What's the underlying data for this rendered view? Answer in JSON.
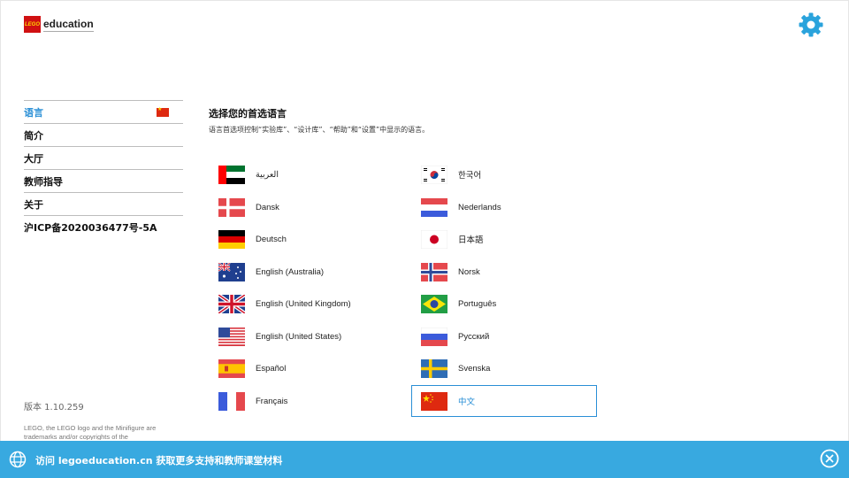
{
  "header": {
    "logo_brick": "LEGO",
    "logo_text": "education"
  },
  "sidebar": {
    "items": [
      {
        "label": "语言",
        "active": true
      },
      {
        "label": "简介"
      },
      {
        "label": "大厅"
      },
      {
        "label": "教师指导"
      },
      {
        "label": "关于"
      },
      {
        "label": "沪ICP备2020036477号-5A"
      }
    ]
  },
  "footer": {
    "version": "版本 1.10.259",
    "legal": "LEGO, the LEGO logo and the Minifigure are trademarks and/or copyrights of the"
  },
  "main": {
    "title": "选择您的首选语言",
    "subtitle": "语言首选项控制“实验库”、“设计库”、“帮助”和“设置”中显示的语言。",
    "languages_left": [
      "العربية",
      "Dansk",
      "Deutsch",
      "English (Australia)",
      "English (United Kingdom)",
      "English (United States)",
      "Español",
      "Français"
    ],
    "languages_right": [
      "한국어",
      "Nederlands",
      "日本語",
      "Norsk",
      "Português",
      "Русский",
      "Svenska",
      "中文"
    ],
    "selected": "中文"
  },
  "banner": {
    "text": "访问 legoeducation.cn 获取更多支持和教师课堂材料"
  },
  "colors": {
    "accent": "#2a8fd6",
    "banner": "#38a9e0",
    "gear": "#2aa3dc",
    "brick": "#d01012"
  },
  "icons": {
    "settings": "gear-icon",
    "banner": "globe-icon",
    "close": "close-icon"
  }
}
